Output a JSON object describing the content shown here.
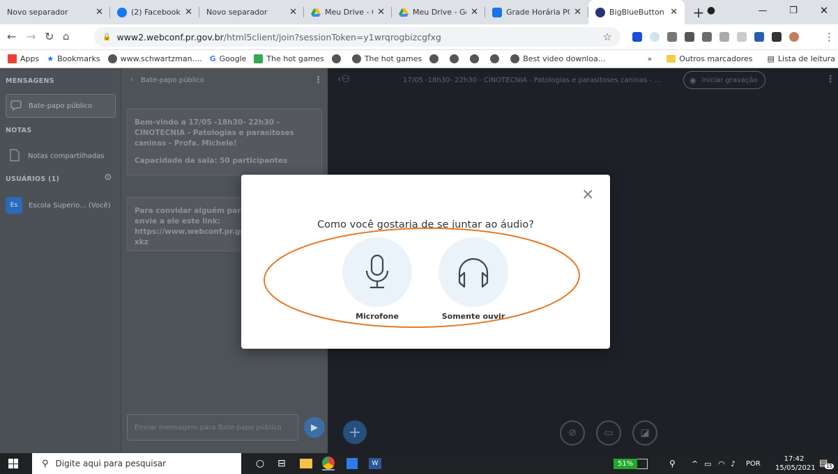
{
  "browser": {
    "tabs": [
      {
        "title": "Novo separador",
        "favicon_color": "",
        "active": false
      },
      {
        "title": "(2) Facebook",
        "favicon_color": "#1877f2",
        "active": false
      },
      {
        "title": "Novo separador",
        "favicon_color": "",
        "active": false
      },
      {
        "title": "Meu Drive - Goo",
        "favicon_color": "#fbbc04",
        "active": false
      },
      {
        "title": "Meu Drive - Goo",
        "favicon_color": "#fbbc04",
        "active": false
      },
      {
        "title": "Grade Horária PC",
        "favicon_color": "#1a73e8",
        "active": false
      },
      {
        "title": "BigBlueButton -",
        "favicon_color": "#283274",
        "active": true
      }
    ],
    "new_tab": "+",
    "url_host": "www2.webconf.pr.gov.br",
    "url_path": "/html5client/join?sessionToken=y1wrqrogbizcgfxg",
    "bookmarks": [
      {
        "label": "Apps",
        "icon": "apps-icon",
        "color": "#e94235"
      },
      {
        "label": "Bookmarks",
        "icon": "star-icon",
        "color": "#1a73e8"
      },
      {
        "label": "www.schwartzman....",
        "icon": "globe-icon",
        "color": "#555"
      },
      {
        "label": "Google",
        "icon": "google-icon",
        "color": "#4285f4"
      },
      {
        "label": "The hot games",
        "icon": "game-icon",
        "color": "#34a853"
      },
      {
        "label": "",
        "icon": "globe-icon",
        "color": "#555"
      },
      {
        "label": "The hot games",
        "icon": "globe-icon",
        "color": "#555"
      },
      {
        "label": "",
        "icon": "globe-icon",
        "color": "#555"
      },
      {
        "label": "",
        "icon": "globe-icon",
        "color": "#555"
      },
      {
        "label": "",
        "icon": "globe-icon",
        "color": "#555"
      },
      {
        "label": "",
        "icon": "globe-icon",
        "color": "#555"
      },
      {
        "label": "Best video downloa...",
        "icon": "globe-icon",
        "color": "#555"
      }
    ],
    "bookmarks_more": "»",
    "other_bookmarks": "Outros marcadores",
    "reading_list": "Lista de leitura"
  },
  "sidebar": {
    "messages_title": "MENSAGENS",
    "public_chat": "Bate-papo público",
    "notes_title": "NOTAS",
    "shared_notes": "Notas compartilhadas",
    "users_title": "USUÁRIOS (1)",
    "user_initials": "Es",
    "user_name": "Escola Superio... (Você)"
  },
  "chat": {
    "title": "Bate-papo público",
    "welcome_line1": "Bem-vindo a 17/05 -18h30- 22h30 - CINOTECNIA - Patologias e parasitoses caninas - Profa. Michele!",
    "welcome_line2": "Capacidade da sala: 50 participantes",
    "invite": "Para convidar alguém para a reunião, envie a ele este link: https://www.webconf.pr.gov.br/b/esc-1mf-xkz",
    "input_placeholder": "Enviar mensagem para Bate-papo público"
  },
  "main": {
    "meeting_title": "17/05 -18h30- 22h30 - CINOTECNIA - Patologias e parasitoses caninas - ...",
    "record_label": "Iniciar gravação"
  },
  "modal": {
    "question": "Como você gostaria de se juntar ao áudio?",
    "microphone_label": "Microfone",
    "listen_label": "Somente ouvir",
    "close": "×",
    "annotation_color": "#e87722"
  },
  "taskbar": {
    "search_placeholder": "Digite aqui para pesquisar",
    "battery": "51%",
    "language": "POR",
    "time": "17:42",
    "date": "15/05/2021",
    "notifications": "15"
  }
}
